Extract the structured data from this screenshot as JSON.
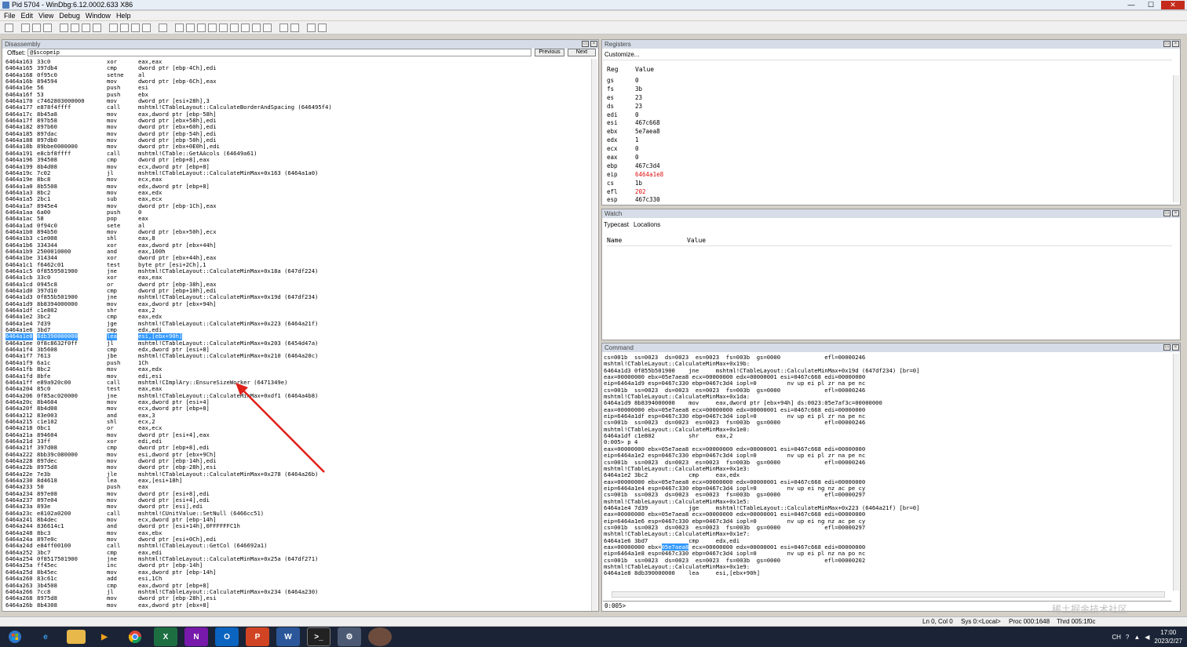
{
  "window": {
    "title": "Pid 5704 - WinDbg:6.12.0002.633 X86",
    "min": "—",
    "max": "☐",
    "close": "✕"
  },
  "menu": [
    "File",
    "Edit",
    "View",
    "Debug",
    "Window",
    "Help"
  ],
  "disassembly": {
    "title": "Disassembly",
    "offset_label": "Offset:",
    "offset_value": "@$scopeip",
    "prev_label": "Previous",
    "next_label": "Next",
    "lines": [
      [
        "6464a163",
        "33c0",
        "xor",
        "eax,eax"
      ],
      [
        "6464a165",
        "397db4",
        "cmp",
        "dword ptr [ebp-4Ch],edi"
      ],
      [
        "6464a168",
        "0f95c0",
        "setne",
        "al"
      ],
      [
        "6464a16b",
        "894594",
        "mov",
        "dword ptr [ebp-6Ch],eax"
      ],
      [
        "6464a16e",
        "56",
        "push",
        "esi"
      ],
      [
        "6464a16f",
        "53",
        "push",
        "ebx"
      ],
      [
        "6464a170",
        "c7462803000000",
        "mov",
        "dword ptr [esi+28h],3"
      ],
      [
        "6464a177",
        "e878f4ffff",
        "call",
        "mshtml!CTableLayout::CalculateBorderAndSpacing (646495f4)"
      ],
      [
        "6464a17c",
        "8b45a8",
        "mov",
        "eax,dword ptr [ebp-58h]"
      ],
      [
        "6464a17f",
        "897b58",
        "mov",
        "dword ptr [ebx+58h],edi"
      ],
      [
        "6464a182",
        "897b60",
        "mov",
        "dword ptr [ebx+60h],edi"
      ],
      [
        "6464a185",
        "897dac",
        "mov",
        "dword ptr [ebp-54h],edi"
      ],
      [
        "6464a188",
        "897db0",
        "mov",
        "dword ptr [ebp-50h],edi"
      ],
      [
        "6464a18b",
        "89bbe0000000",
        "mov",
        "dword ptr [ebx+0E0h],edi"
      ],
      [
        "6464a191",
        "e8cbf8ffff",
        "call",
        "mshtml!CTable::GetAAcols (64649a61)"
      ],
      [
        "6464a196",
        "394508",
        "cmp",
        "dword ptr [ebp+8],eax"
      ],
      [
        "6464a199",
        "8b4d08",
        "mov",
        "ecx,dword ptr [ebp+8]"
      ],
      [
        "6464a19c",
        "7c02",
        "jl",
        "mshtml!CTableLayout::CalculateMinMax+0x163 (6464a1a0)"
      ],
      [
        "6464a19e",
        "8bc8",
        "mov",
        "ecx,eax"
      ],
      [
        "6464a1a0",
        "8b5508",
        "mov",
        "edx,dword ptr [ebp+8]"
      ],
      [
        "6464a1a3",
        "8bc2",
        "mov",
        "eax,edx"
      ],
      [
        "6464a1a5",
        "2bc1",
        "sub",
        "eax,ecx"
      ],
      [
        "6464a1a7",
        "8945e4",
        "mov",
        "dword ptr [ebp-1Ch],eax"
      ],
      [
        "6464a1aa",
        "6a00",
        "push",
        "0"
      ],
      [
        "6464a1ac",
        "58",
        "pop",
        "eax"
      ],
      [
        "6464a1ad",
        "0f94c0",
        "sete",
        "al"
      ],
      [
        "6464a1b0",
        "894b50",
        "mov",
        "dword ptr [ebx+50h],ecx"
      ],
      [
        "6464a1b3",
        "c1e008",
        "shl",
        "eax,8"
      ],
      [
        "6464a1b6",
        "334344",
        "xor",
        "eax,dword ptr [ebx+44h]"
      ],
      [
        "6464a1b9",
        "2500010000",
        "and",
        "eax,100h"
      ],
      [
        "6464a1be",
        "314344",
        "xor",
        "dword ptr [ebx+44h],eax"
      ],
      [
        "6464a1c1",
        "f6462c01",
        "test",
        "byte ptr [esi+2Ch],1"
      ],
      [
        "6464a1c5",
        "0f8559501900",
        "jne",
        "mshtml!CTableLayout::CalculateMinMax+0x18a (647df224)"
      ],
      [
        "6464a1cb",
        "33c0",
        "xor",
        "eax,eax"
      ],
      [
        "6464a1cd",
        "0945c8",
        "or",
        "dword ptr [ebp-38h],eax"
      ],
      [
        "6464a1d0",
        "397d10",
        "cmp",
        "dword ptr [ebp+10h],edi"
      ],
      [
        "6464a1d3",
        "0f855b501900",
        "jne",
        "mshtml!CTableLayout::CalculateMinMax+0x19d (647df234)"
      ],
      [
        "6464a1d9",
        "8b8394000000",
        "mov",
        "eax,dword ptr [ebx+94h]"
      ],
      [
        "6464a1df",
        "c1e802",
        "shr",
        "eax,2"
      ],
      [
        "6464a1e2",
        "3bc2",
        "cmp",
        "eax,edx"
      ],
      [
        "6464a1e4",
        "7d39",
        "jge",
        "mshtml!CTableLayout::CalculateMinMax+0x223 (6464a21f)"
      ],
      [
        "6464a1e6",
        "3bd7",
        "cmp",
        "edx,edi"
      ],
      [
        "6464a1e8",
        "8db390000000",
        "lea",
        "esi,[ebx+90h]"
      ],
      [
        "6464a1ee",
        "0f8c8632f0ff",
        "jl",
        "mshtml!CTableLayout::CalculateMinMax+0x203 (6454d47a)"
      ],
      [
        "6464a1f4",
        "3b5608",
        "cmp",
        "edx,dword ptr [esi+8]"
      ],
      [
        "6464a1f7",
        "7613",
        "jbe",
        "mshtml!CTableLayout::CalculateMinMax+0x210 (6464a20c)"
      ],
      [
        "6464a1f9",
        "6a1c",
        "push",
        "1Ch"
      ],
      [
        "6464a1fb",
        "8bc2",
        "mov",
        "eax,edx"
      ],
      [
        "6464a1fd",
        "8bfe",
        "mov",
        "edi,esi"
      ],
      [
        "6464a1ff",
        "e89a920c00",
        "call",
        "mshtml!CImplAry::EnsureSizeWorker (6471349e)"
      ],
      [
        "6464a204",
        "85c0",
        "test",
        "eax,eax"
      ],
      [
        "6464a206",
        "0f85ac020000",
        "jne",
        "mshtml!CTableLayout::CalculateMinMax+0xdf1 (6464a4b8)"
      ],
      [
        "6464a20c",
        "8b4604",
        "mov",
        "eax,dword ptr [esi+4]"
      ],
      [
        "6464a20f",
        "8b4d08",
        "mov",
        "ecx,dword ptr [ebp+8]"
      ],
      [
        "6464a212",
        "83e003",
        "and",
        "eax,3"
      ],
      [
        "6464a215",
        "c1e102",
        "shl",
        "ecx,2"
      ],
      [
        "6464a218",
        "0bc1",
        "or",
        "eax,ecx"
      ],
      [
        "6464a21a",
        "894604",
        "mov",
        "dword ptr [esi+4],eax"
      ],
      [
        "6464a21d",
        "33ff",
        "xor",
        "edi,edi"
      ],
      [
        "6464a21f",
        "397d08",
        "cmp",
        "dword ptr [ebp+8],edi"
      ],
      [
        "6464a222",
        "8bb39c080000",
        "mov",
        "esi,dword ptr [ebx+9Ch]"
      ],
      [
        "6464a228",
        "897dec",
        "mov",
        "dword ptr [ebp-14h],edi"
      ],
      [
        "6464a22b",
        "8975d8",
        "mov",
        "dword ptr [ebp-28h],esi"
      ],
      [
        "6464a22e",
        "7e3b",
        "jle",
        "mshtml!CTableLayout::CalculateMinMax+0x278 (6464a26b)"
      ],
      [
        "6464a230",
        "8d4618",
        "lea",
        "eax,[esi+18h]"
      ],
      [
        "6464a233",
        "50",
        "push",
        "eax"
      ],
      [
        "6464a234",
        "897e08",
        "mov",
        "dword ptr [esi+8],edi"
      ],
      [
        "6464a237",
        "897e04",
        "mov",
        "dword ptr [esi+4],edi"
      ],
      [
        "6464a23a",
        "893e",
        "mov",
        "dword ptr [esi],edi"
      ],
      [
        "6464a23c",
        "e8102a0200",
        "call",
        "mshtml!CUnitValue::SetNull (6466cc51)"
      ],
      [
        "6464a241",
        "8b4dec",
        "mov",
        "ecx,dword ptr [ebp-14h]"
      ],
      [
        "6464a244",
        "836614c1",
        "and",
        "dword ptr [esi+14h],0FFFFFFC1h"
      ],
      [
        "6464a248",
        "8bc3",
        "mov",
        "eax,ebx"
      ],
      [
        "6464a24a",
        "897e0c",
        "mov",
        "dword ptr [esi+0Ch],edi"
      ],
      [
        "6464a24d",
        "e84ff00100",
        "call",
        "mshtml!CTableLayout::GetCol (646692a1)"
      ],
      [
        "6464a252",
        "3bc7",
        "cmp",
        "eax,edi"
      ],
      [
        "6464a254",
        "0f8517501900",
        "jne",
        "mshtml!CTableLayout::CalculateMinMax+0x25a (647df271)"
      ],
      [
        "6464a25a",
        "ff45ec",
        "inc",
        "dword ptr [ebp-14h]"
      ],
      [
        "6464a25d",
        "8b45ec",
        "mov",
        "eax,dword ptr [ebp-14h]"
      ],
      [
        "6464a260",
        "83c61c",
        "add",
        "esi,1Ch"
      ],
      [
        "6464a263",
        "3b4508",
        "cmp",
        "eax,dword ptr [ebp+8]"
      ],
      [
        "6464a266",
        "7cc8",
        "jl",
        "mshtml!CTableLayout::CalculateMinMax+0x234 (6464a230)"
      ],
      [
        "6464a268",
        "8975d8",
        "mov",
        "dword ptr [ebp-28h],esi"
      ],
      [
        "6464a26b",
        "8b4308",
        "mov",
        "eax,dword ptr [ebx+8]"
      ]
    ],
    "highlight_index": 42
  },
  "registers": {
    "title": "Registers",
    "customize": "Customize...",
    "col_reg": "Reg",
    "col_value": "Value",
    "rows": [
      [
        "gs",
        "0"
      ],
      [
        "fs",
        "3b"
      ],
      [
        "es",
        "23"
      ],
      [
        "ds",
        "23"
      ],
      [
        "edi",
        "0"
      ],
      [
        "esi",
        "467c668"
      ],
      [
        "ebx",
        "5e7aea8"
      ],
      [
        "edx",
        "1"
      ],
      [
        "ecx",
        "0"
      ],
      [
        "eax",
        "0"
      ],
      [
        "ebp",
        "467c3d4"
      ],
      [
        "eip",
        "6464a1e8"
      ],
      [
        "cs",
        "1b"
      ],
      [
        "efl",
        "202"
      ],
      [
        "esp",
        "467c330"
      ]
    ],
    "changed": [
      "eip",
      "efl"
    ],
    "changed_color": "#e01010"
  },
  "watch": {
    "title": "Watch",
    "tab_typecast": "Typecast",
    "tab_locations": "Locations",
    "col_name": "Name",
    "col_value": "Value"
  },
  "command": {
    "title": "Command",
    "lines": [
      "cs=001b  ss=0023  ds=0023  es=0023  fs=003b  gs=0000             efl=00000246",
      "mshtml!CTableLayout::CalculateMinMax+0x19b:",
      "6464a1d3 0f855b501900    jne     mshtml!CTableLayout::CalculateMinMax+0x19d (647df234) [br=0]",
      "eax=00000000 ebx=05e7aea8 ecx=00000000 edx=00000001 esi=0467c668 edi=00000000",
      "eip=6464a1d9 esp=0467c330 ebp=0467c3d4 iopl=0         nv up ei pl zr na pe nc",
      "cs=001b  ss=0023  ds=0023  es=0023  fs=003b  gs=0000             efl=00000246",
      "mshtml!CTableLayout::CalculateMinMax+0x1da:",
      "6464a1d9 8b8394000000    mov     eax,dword ptr [ebx+94h] ds:0023:05e7af3c=00000000",
      "eax=00000000 ebx=05e7aea8 ecx=00000000 edx=00000001 esi=0467c668 edi=00000000",
      "eip=6464a1df esp=0467c330 ebp=0467c3d4 iopl=0         nv up ei pl zr na pe nc",
      "cs=001b  ss=0023  ds=0023  es=0023  fs=003b  gs=0000             efl=00000246",
      "mshtml!CTableLayout::CalculateMinMax+0x1e0:",
      "6464a1df c1e802          shr     eax,2",
      "0:005> p 4",
      "eax=00000000 ebx=05e7aea8 ecx=00000000 edx=00000001 esi=0467c668 edi=00000000",
      "eip=6464a1e2 esp=0467c330 ebp=0467c3d4 iopl=0         nv up ei pl zr na pe nc",
      "cs=001b  ss=0023  ds=0023  es=0023  fs=003b  gs=0000             efl=00000246",
      "mshtml!CTableLayout::CalculateMinMax+0x1e3:",
      "6464a1e2 3bc2            cmp     eax,edx",
      "eax=00000000 ebx=05e7aea8 ecx=00000000 edx=00000001 esi=0467c668 edi=00000000",
      "eip=6464a1e4 esp=0467c330 ebp=0467c3d4 iopl=0         nv up ei ng nz ac pe cy",
      "cs=001b  ss=0023  ds=0023  es=0023  fs=003b  gs=0000             efl=00000297",
      "mshtml!CTableLayout::CalculateMinMax+0x1e5:",
      "6464a1e4 7d39            jge     mshtml!CTableLayout::CalculateMinMax+0x223 (6464a21f) [br=0]",
      "eax=00000000 ebx=05e7aea8 ecx=00000000 edx=00000001 esi=0467c668 edi=00000000",
      "eip=6464a1e6 esp=0467c330 ebp=0467c3d4 iopl=0         nv up ei ng nz ac pe cy",
      "cs=001b  ss=0023  ds=0023  es=0023  fs=003b  gs=0000             efl=00000297",
      "mshtml!CTableLayout::CalculateMinMax+0x1e7:",
      "6464a1e6 3bd7            cmp     edx,edi",
      "eax=00000000 ebx=05e7aea8 ecx=00000000 edx=00000001 esi=0467c668 edi=00000000",
      "eip=6464a1e8 esp=0467c330 ebp=0467c3d4 iopl=0         nv up ei pl nz na po nc",
      "cs=001b  ss=0023  ds=0023  es=0023  fs=003b  gs=0000             efl=00000202",
      "mshtml!CTableLayout::CalculateMinMax+0x1e9:",
      "6464a1e8 8db390000000    lea     esi,[ebx+90h]"
    ],
    "highlight_line": 29,
    "highlight_text": "05e7aea8",
    "prompt": "0:005>"
  },
  "status": {
    "pos": "Ln 0, Col 0",
    "sys": "Sys 0:<Local>",
    "proc": "Proc 000:1648",
    "thrd": "Thrd 005:1f0c"
  },
  "taskbar": {
    "apps": [
      "start-icon",
      "ie-icon",
      "explorer-icon",
      "media-player-icon",
      "chrome-icon",
      "excel-icon",
      "onenote-icon",
      "outlook-icon",
      "powerpoint-icon",
      "word-icon",
      "cmd-icon",
      "windbg-icon",
      "photo-icon"
    ],
    "lang": "CH",
    "time": "17:00",
    "date": "2023/2/27"
  },
  "watermark": "稀土掘金技术社区",
  "annotation_color": "#e0201a"
}
